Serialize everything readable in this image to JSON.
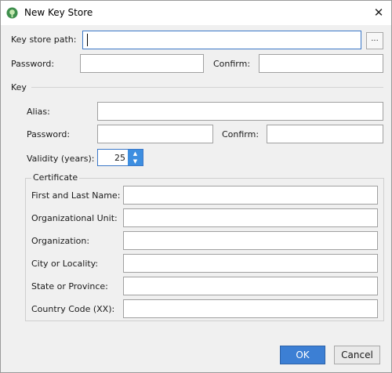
{
  "window": {
    "title": "New Key Store"
  },
  "keystore": {
    "path_label": "Key store path:",
    "path_value": "",
    "browse_label": "...",
    "password_label": "Password:",
    "confirm_label": "Confirm:"
  },
  "key": {
    "section_label": "Key",
    "alias_label": "Alias:",
    "password_label": "Password:",
    "confirm_label": "Confirm:",
    "validity_label": "Validity (years):",
    "validity_value": "25"
  },
  "certificate": {
    "group_label": "Certificate",
    "fields": [
      {
        "label": "First and Last Name:",
        "value": ""
      },
      {
        "label": "Organizational Unit:",
        "value": ""
      },
      {
        "label": "Organization:",
        "value": ""
      },
      {
        "label": "City or Locality:",
        "value": ""
      },
      {
        "label": "State or Province:",
        "value": ""
      },
      {
        "label": "Country Code (XX):",
        "value": ""
      }
    ]
  },
  "buttons": {
    "ok": "OK",
    "cancel": "Cancel"
  },
  "colors": {
    "accent": "#3c7fd4",
    "focus_border": "#3c78c8",
    "dialog_bg": "#f0f0f0"
  },
  "icons": {
    "app": "android-studio-icon",
    "close": "close-icon",
    "spin_up": "arrow-up-icon",
    "spin_down": "arrow-down-icon"
  }
}
